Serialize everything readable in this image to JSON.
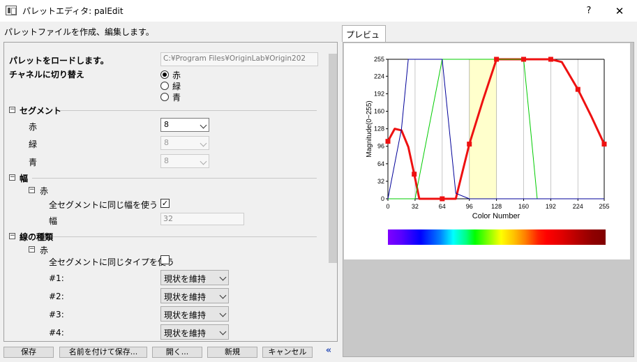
{
  "window": {
    "title": "パレットエディタ: palEdit",
    "help_label": "?",
    "close_label": "✕",
    "description": "パレットファイルを作成、編集します。"
  },
  "settings": {
    "load_palette_label": "パレットをロードします。",
    "load_palette_path": "C:¥Program Files¥OriginLab¥Origin202",
    "channel_switch_label": "チャネルに切り替え",
    "channels": [
      "赤",
      "緑",
      "青"
    ],
    "selected_channel": "赤",
    "segment_section": "セグメント",
    "segment_rows": [
      {
        "label": "赤",
        "value": "8",
        "enabled": true
      },
      {
        "label": "緑",
        "value": "8",
        "enabled": false
      },
      {
        "label": "青",
        "value": "8",
        "enabled": false
      }
    ],
    "width_section": "幅",
    "width_red_node": "赤",
    "width_same_label": "全セグメントに同じ幅を使う",
    "width_same_checked": true,
    "width_label": "幅",
    "width_value": "32",
    "linetype_section": "線の種類",
    "linetype_red_node": "赤",
    "linetype_same_label": "全セグメントに同じタイプを使う",
    "linetype_same_checked": false,
    "linetype_rows": [
      {
        "label": "#1:",
        "value": "現状を維持"
      },
      {
        "label": "#2:",
        "value": "現状を維持"
      },
      {
        "label": "#3:",
        "value": "現状を維持"
      },
      {
        "label": "#4:",
        "value": "現状を維持"
      }
    ]
  },
  "buttons": {
    "save": "保存",
    "save_as": "名前を付けて保存...",
    "open": "開く...",
    "new": "新規",
    "cancel": "キャンセル",
    "collapse": "«"
  },
  "preview_tab": "プレビュー",
  "colors": {
    "red_channel": "#ee1111",
    "green_channel": "#00cc00",
    "blue_channel": "#000099",
    "highlight_segment": "#ffffcc"
  },
  "chart_data": {
    "type": "line",
    "xlabel": "Color Number",
    "ylabel": "Magnitude(0~255)",
    "xlim": [
      0,
      255
    ],
    "ylim": [
      0,
      255
    ],
    "xticks": [
      0,
      32,
      64,
      96,
      128,
      160,
      192,
      224,
      255
    ],
    "yticks": [
      0,
      32,
      64,
      96,
      128,
      160,
      192,
      224,
      255
    ],
    "highlight_range": [
      96,
      128
    ],
    "series": [
      {
        "color_key": "red_channel",
        "points": [
          [
            0,
            105
          ],
          [
            8,
            128
          ],
          [
            16,
            125
          ],
          [
            24,
            95
          ],
          [
            31,
            45
          ],
          [
            37,
            0
          ],
          [
            64,
            0
          ],
          [
            80,
            0
          ],
          [
            88,
            50
          ],
          [
            96,
            100
          ],
          [
            112,
            180
          ],
          [
            128,
            255
          ],
          [
            160,
            255
          ],
          [
            192,
            255
          ],
          [
            205,
            250
          ],
          [
            224,
            200
          ],
          [
            240,
            150
          ],
          [
            255,
            100
          ]
        ]
      },
      {
        "color_key": "green_channel",
        "points": [
          [
            0,
            0
          ],
          [
            32,
            0
          ],
          [
            64,
            255
          ],
          [
            96,
            255
          ],
          [
            128,
            255
          ],
          [
            160,
            255
          ],
          [
            168,
            130
          ],
          [
            176,
            0
          ],
          [
            255,
            0
          ]
        ]
      },
      {
        "color_key": "blue_channel",
        "points": [
          [
            0,
            0
          ],
          [
            16,
            128
          ],
          [
            24,
            255
          ],
          [
            32,
            255
          ],
          [
            64,
            255
          ],
          [
            80,
            10
          ],
          [
            96,
            0
          ],
          [
            255,
            0
          ]
        ]
      }
    ],
    "markers": [
      [
        0,
        105
      ],
      [
        31,
        45
      ],
      [
        64,
        0
      ],
      [
        96,
        100
      ],
      [
        128,
        255
      ],
      [
        160,
        255
      ],
      [
        192,
        255
      ],
      [
        224,
        200
      ],
      [
        255,
        100
      ]
    ]
  }
}
